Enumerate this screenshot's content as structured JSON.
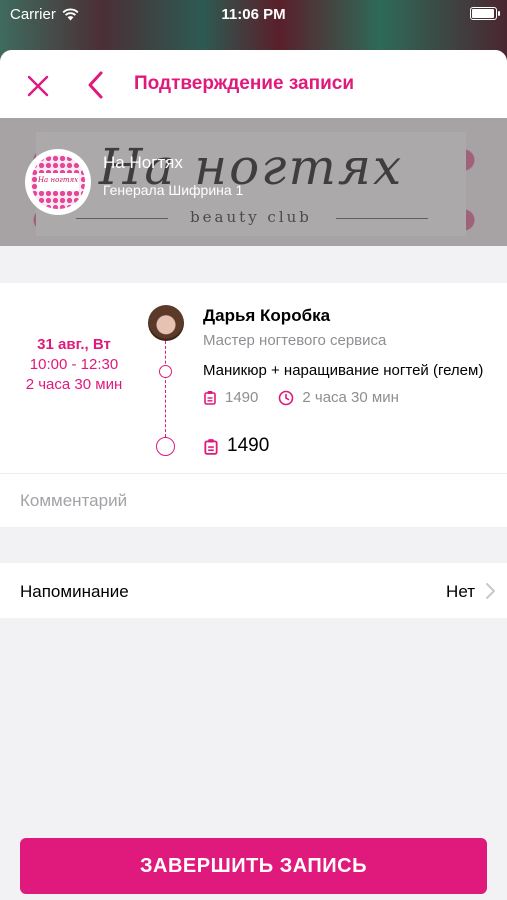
{
  "status_bar": {
    "carrier": "Carrier",
    "time": "11:06 PM",
    "battery_level": 0.95
  },
  "navigation": {
    "title": "Подтверждение записи",
    "close_icon": "close-icon",
    "back_icon": "chevron-left-icon"
  },
  "salon": {
    "name": "На Ногтях",
    "address": "Генерала Шифрина 1",
    "banner_script": "На ногтях",
    "banner_subtitle": "beauty club",
    "logo_text": "На ногтях"
  },
  "appointment": {
    "date": "31 авг., Вт",
    "time_range": "10:00 - 12:30",
    "duration": "2 часа 30 мин",
    "master": {
      "name": "Дарья Коробка",
      "role": "Мастер ногтевого сервиса"
    },
    "service": {
      "name": "Маникюр + наращивание ногтей (гелем)",
      "price": "1490",
      "duration": "2 часа 30 мин"
    },
    "total": "1490"
  },
  "comment": {
    "placeholder": "Комментарий",
    "value": ""
  },
  "reminder": {
    "label": "Напоминание",
    "value": "Нет"
  },
  "submit": {
    "label": "ЗАВЕРШИТЬ ЗАПИСЬ"
  },
  "colors": {
    "accent": "#e0197d",
    "secondary_text": "#8e8e93",
    "background": "#f2f2f4"
  }
}
